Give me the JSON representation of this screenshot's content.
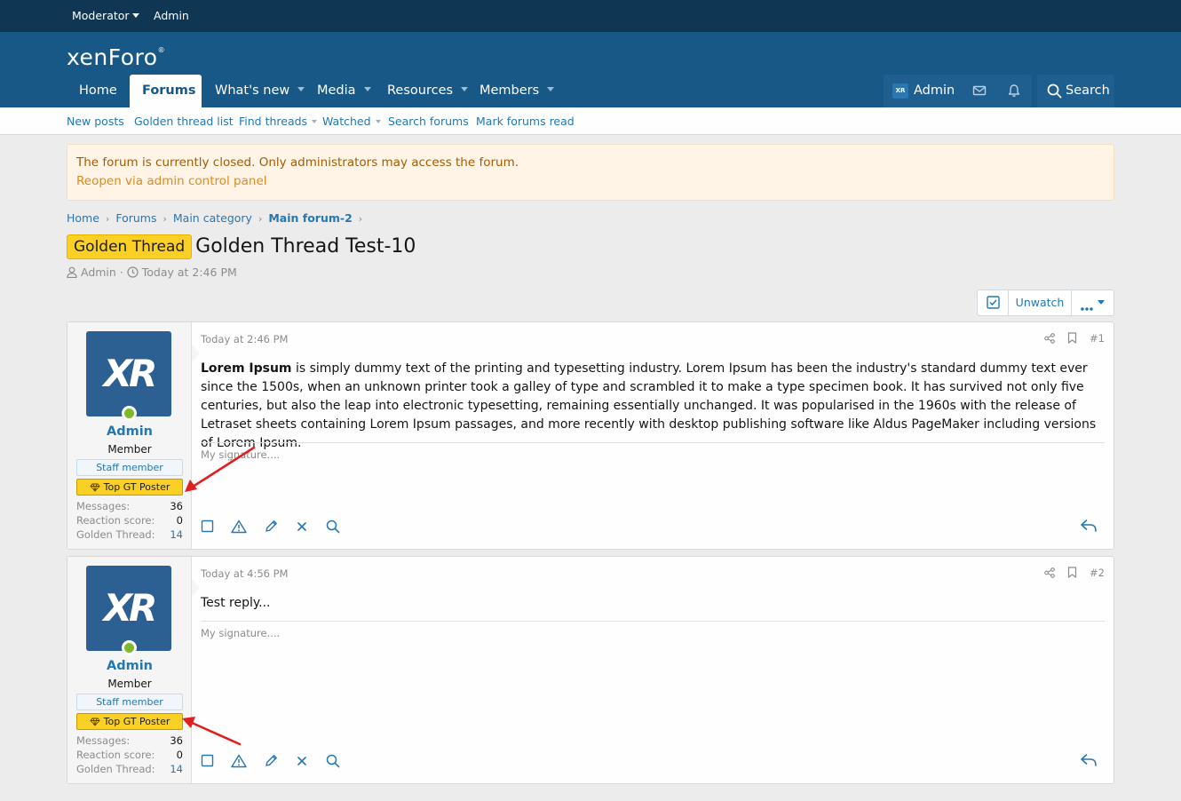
{
  "topbar": {
    "moderator": "Moderator",
    "admin": "Admin"
  },
  "header": {
    "logo": "xenForo"
  },
  "nav": {
    "home": "Home",
    "forums": "Forums",
    "whats_new": "What's new",
    "media": "Media",
    "resources": "Resources",
    "members": "Members",
    "user": "Admin",
    "search": "Search"
  },
  "subnav": {
    "new_posts": "New posts",
    "golden_thread_list": "Golden thread list",
    "find_threads": "Find threads",
    "watched": "Watched",
    "search_forums": "Search forums",
    "mark_read": "Mark forums read"
  },
  "notice": {
    "message": "The forum is currently closed. Only administrators may access the forum.",
    "link": "Reopen via admin control panel"
  },
  "breadcrumb": [
    "Home",
    "Forums",
    "Main category",
    "Main forum-2"
  ],
  "thread": {
    "badge": "Golden Thread",
    "title": "Golden Thread Test-10",
    "author": "Admin",
    "date": "Today at 2:46 PM"
  },
  "thread_buttons": {
    "unwatch": "Unwatch"
  },
  "posts": [
    {
      "time": "Today at 2:46 PM",
      "number": "#1",
      "body_bold": "Lorem Ipsum",
      "body": " is simply dummy text of the printing and typesetting industry. Lorem Ipsum has been the industry's standard dummy text ever since the 1500s, when an unknown printer took a galley of type and scrambled it to make a type specimen book. It has survived not only five centuries, but also the leap into electronic typesetting, remaining essentially unchanged. It was popularised in the 1960s with the release of Letraset sheets containing Lorem Ipsum passages, and more recently with desktop publishing software like Aldus PageMaker including versions of Lorem Ipsum.",
      "signature": "My signature....",
      "user": {
        "avatar_text": "XR",
        "name": "Admin",
        "title": "Member",
        "staff": "Staff member",
        "top_gt": "Top GT Poster",
        "messages_label": "Messages:",
        "messages": "36",
        "reaction_label": "Reaction score:",
        "reaction": "0",
        "golden_label": "Golden Thread:",
        "golden": "14"
      }
    },
    {
      "time": "Today at 4:56 PM",
      "number": "#2",
      "body_bold": "",
      "body": "Test reply...",
      "signature": "My signature....",
      "user": {
        "avatar_text": "XR",
        "name": "Admin",
        "title": "Member",
        "staff": "Staff member",
        "top_gt": "Top GT Poster",
        "messages_label": "Messages:",
        "messages": "36",
        "reaction_label": "Reaction score:",
        "reaction": "0",
        "golden_label": "Golden Thread:",
        "golden": "14"
      }
    }
  ],
  "colors": {
    "topbar": "#0f3652",
    "header": "#185886",
    "link": "#2577b1",
    "golden": "#fbd025",
    "notice_bg": "#fff4e5",
    "online": "#7fb82b",
    "annotation_arrow": "#e02020"
  }
}
